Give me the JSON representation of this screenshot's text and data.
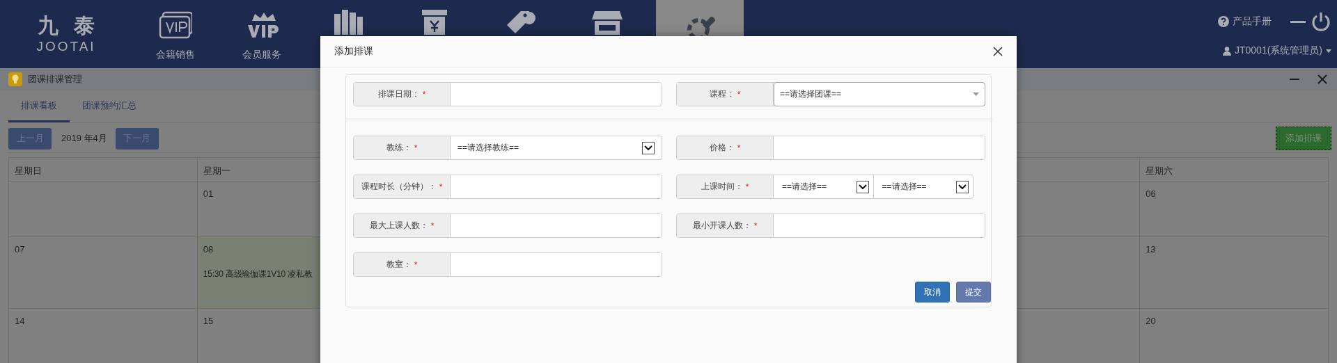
{
  "nav": {
    "logo": {
      "mark": "九泰",
      "name": "JOOTAI"
    },
    "items": [
      {
        "kind": "vip-card",
        "label": "会籍销售",
        "selected": false
      },
      {
        "kind": "vip-crown",
        "label": "会员服务",
        "selected": false
      },
      {
        "kind": "books",
        "selected": false
      },
      {
        "kind": "receipt",
        "selected": false
      },
      {
        "kind": "tag",
        "selected": false
      },
      {
        "kind": "store",
        "selected": false
      },
      {
        "kind": "tools",
        "selected": true
      }
    ],
    "manual": "产品手册",
    "user": "JT0001(系统管理员)"
  },
  "panel": {
    "title": "团课排课管理",
    "tabs": [
      {
        "label": "排课看板",
        "selected": true
      },
      {
        "label": "团课预约汇总",
        "selected": false
      }
    ],
    "prev": "上一月",
    "month": "2019 年4月",
    "next": "下一月",
    "add": "添加排课",
    "calendar": {
      "columns": [
        "星期日",
        "星期一",
        null,
        null,
        null,
        null,
        "星期六"
      ],
      "rows": [
        {
          "cells": [
            null,
            {
              "day": "01",
              "highlighted": false
            },
            null,
            null,
            null,
            null,
            {
              "day": "06",
              "highlighted": false
            }
          ]
        },
        {
          "cells": [
            {
              "day": "07",
              "highlighted": false
            },
            {
              "day": "08",
              "highlighted": true,
              "events": [
                "15:30 高级瑜伽课1V10 凌私教"
              ]
            },
            null,
            null,
            null,
            null,
            {
              "day": "13",
              "highlighted": false
            }
          ]
        },
        {
          "cells": [
            {
              "day": "14",
              "highlighted": false
            },
            {
              "day": "15",
              "highlighted": false
            },
            null,
            null,
            null,
            null,
            {
              "day": "20",
              "highlighted": false
            }
          ]
        }
      ]
    }
  },
  "modal": {
    "title": "添加排课",
    "fields": [
      {
        "label": "排课日期：",
        "mark": "*",
        "kind": "text"
      },
      {
        "label": "课程：",
        "mark": "*",
        "kind": "combo",
        "value": "==请选择团课=="
      },
      {
        "label": "教练：",
        "mark": "*",
        "kind": "select",
        "value": "==请选择教练=="
      },
      {
        "label": "价格：",
        "mark": "*",
        "kind": "text"
      },
      {
        "label": "课程时长（分钟）：",
        "mark": "*",
        "kind": "text"
      },
      {
        "label": "上课时间：",
        "mark": "*",
        "kind": "time",
        "values": [
          "==请选择==",
          "==请选择=="
        ]
      },
      {
        "label": "最大上课人数：",
        "mark": "*",
        "kind": "text"
      },
      {
        "label": "最小开课人数：",
        "mark": "*",
        "kind": "text"
      },
      {
        "label": "教室：",
        "mark": "*",
        "kind": "text"
      }
    ],
    "buttons": [
      {
        "label": "取消",
        "kind": "cancel"
      },
      {
        "label": "提交",
        "kind": "submit"
      }
    ]
  }
}
